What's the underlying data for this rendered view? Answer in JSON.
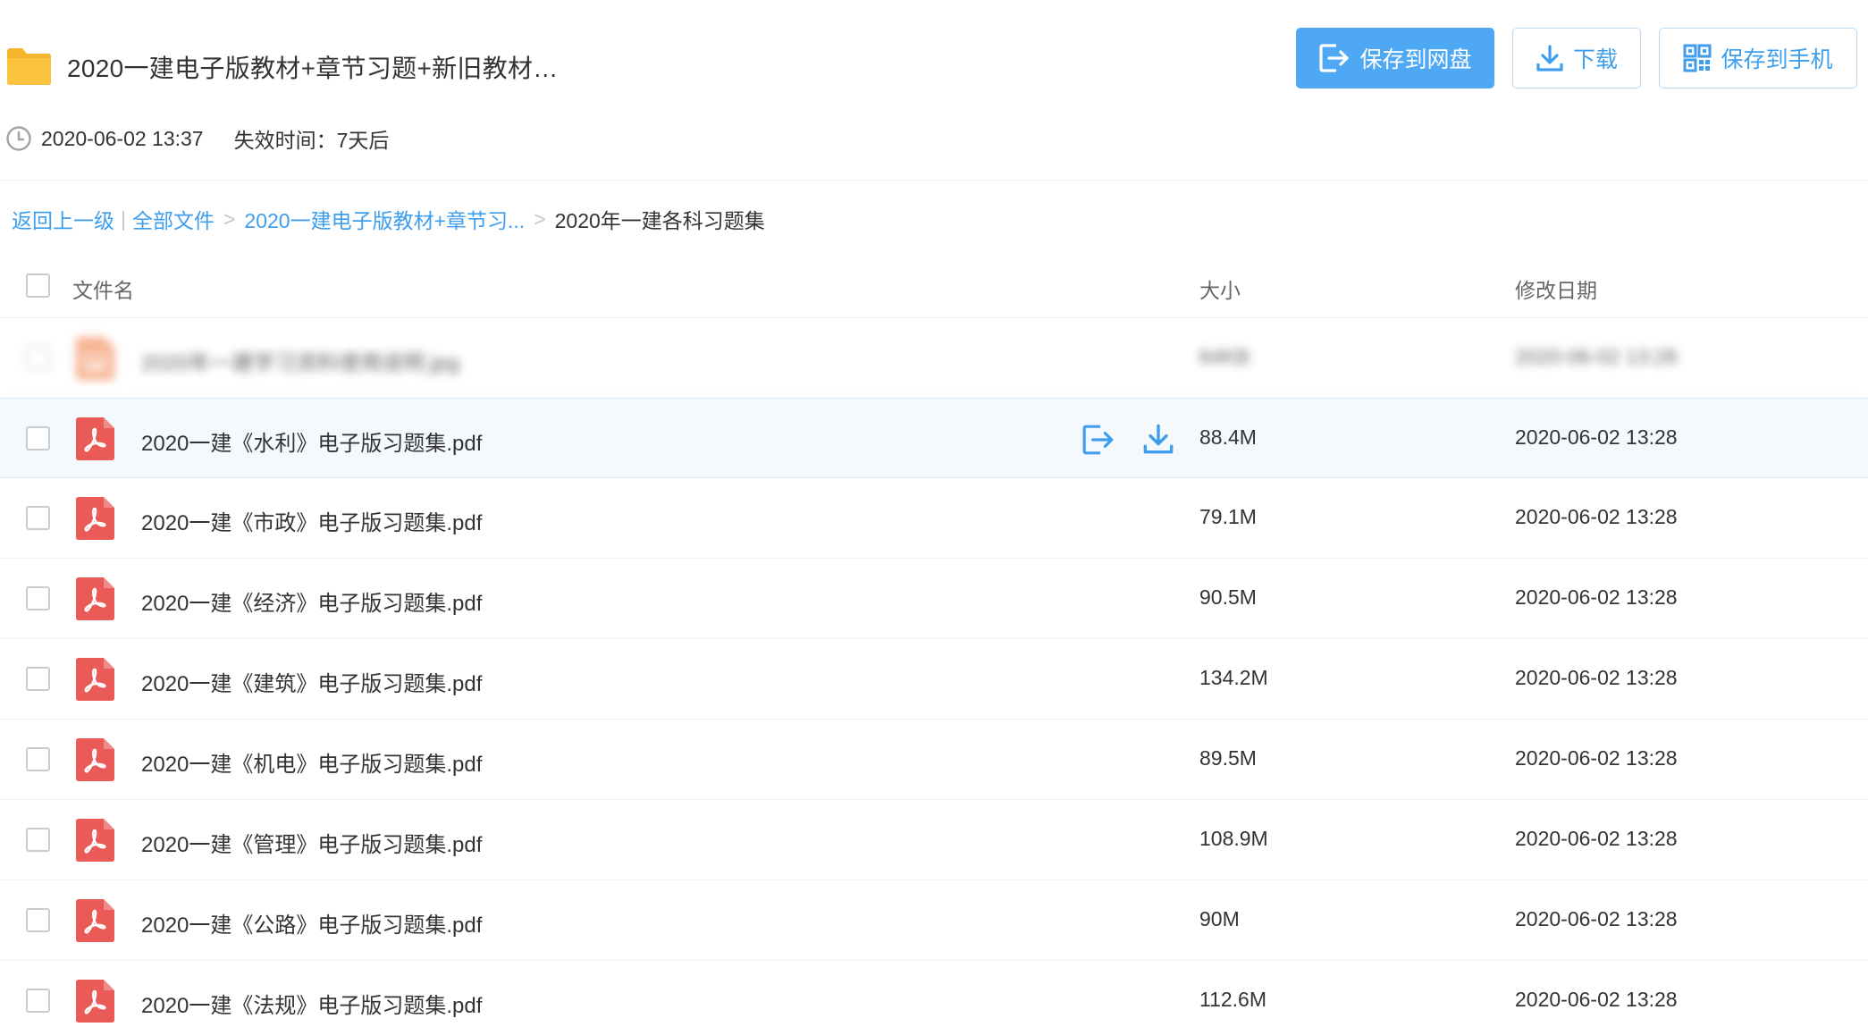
{
  "share": {
    "title": "2020一建电子版教材+章节习题+新旧教材…",
    "date": "2020-06-02 13:37",
    "expire": "失效时间：7天后"
  },
  "actions": {
    "save_label": "保存到网盘",
    "download_label": "下载",
    "phone_label": "保存到手机"
  },
  "breadcrumb": {
    "back": "返回上一级",
    "all_files": "全部文件",
    "parent": "2020一建电子版教材+章节习...",
    "current": "2020年一建各科习题集",
    "separator": ">",
    "divider": "|"
  },
  "table": {
    "columns": {
      "name": "文件名",
      "size": "大小",
      "date": "修改日期"
    },
    "rows": [
      {
        "name": "2020年一建学习资料使用说明.jpg",
        "size": "64KB",
        "date": "2020-06-02 13:28",
        "type": "image",
        "blurred": true
      },
      {
        "name": "2020一建《水利》电子版习题集.pdf",
        "size": "88.4M",
        "date": "2020-06-02 13:28",
        "type": "pdf",
        "hovered": true
      },
      {
        "name": "2020一建《市政》电子版习题集.pdf",
        "size": "79.1M",
        "date": "2020-06-02 13:28",
        "type": "pdf"
      },
      {
        "name": "2020一建《经济》电子版习题集.pdf",
        "size": "90.5M",
        "date": "2020-06-02 13:28",
        "type": "pdf"
      },
      {
        "name": "2020一建《建筑》电子版习题集.pdf",
        "size": "134.2M",
        "date": "2020-06-02 13:28",
        "type": "pdf"
      },
      {
        "name": "2020一建《机电》电子版习题集.pdf",
        "size": "89.5M",
        "date": "2020-06-02 13:28",
        "type": "pdf"
      },
      {
        "name": "2020一建《管理》电子版习题集.pdf",
        "size": "108.9M",
        "date": "2020-06-02 13:28",
        "type": "pdf"
      },
      {
        "name": "2020一建《公路》电子版习题集.pdf",
        "size": "90M",
        "date": "2020-06-02 13:28",
        "type": "pdf"
      },
      {
        "name": "2020一建《法规》电子版习题集.pdf",
        "size": "112.6M",
        "date": "2020-06-02 13:28",
        "type": "pdf"
      }
    ]
  },
  "colors": {
    "accent": "#4fa8f4",
    "link": "#3e9eee",
    "pdf_red": "#ea5a57",
    "folder_yellow": "#fcc33f"
  },
  "icons": {
    "folder": "folder-icon",
    "clock": "clock-icon",
    "save": "save-to-cloud-icon",
    "download": "download-icon",
    "qrcode": "qrcode-icon",
    "pdf": "pdf-file-icon",
    "image": "image-file-icon"
  }
}
